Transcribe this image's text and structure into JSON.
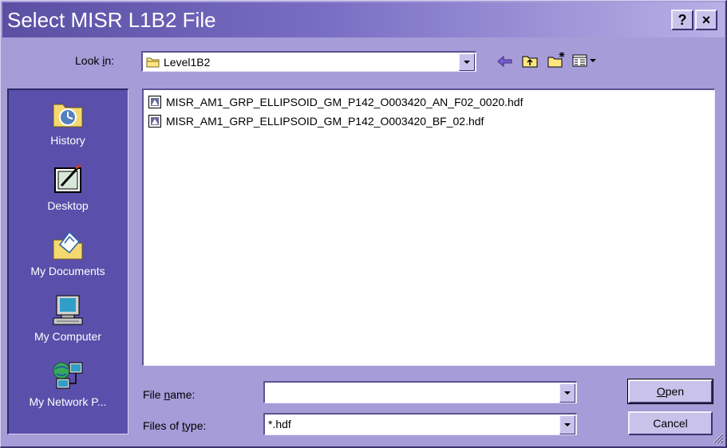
{
  "window": {
    "title": "Select MISR L1B2 File",
    "help_button": "?",
    "close_button": "×"
  },
  "look_in": {
    "label_prefix": "Look ",
    "label_key": "i",
    "label_suffix": "n:",
    "value": "Level1B2"
  },
  "toolbar": {
    "icons": [
      "back-arrow-icon",
      "up-one-level-icon",
      "new-folder-icon",
      "view-menu-icon"
    ]
  },
  "places": [
    {
      "label": "History",
      "icon": "history-icon"
    },
    {
      "label": "Desktop",
      "icon": "desktop-icon"
    },
    {
      "label": "My Documents",
      "icon": "my-documents-icon"
    },
    {
      "label": "My Computer",
      "icon": "my-computer-icon"
    },
    {
      "label": "My Network P...",
      "icon": "network-places-icon"
    }
  ],
  "files": [
    {
      "name": "MISR_AM1_GRP_ELLIPSOID_GM_P142_O003420_AN_F02_0020.hdf"
    },
    {
      "name": "MISR_AM1_GRP_ELLIPSOID_GM_P142_O003420_BF_02.hdf"
    }
  ],
  "file_name": {
    "label_prefix": "File ",
    "label_key": "n",
    "label_suffix": "ame:",
    "value": ""
  },
  "file_type": {
    "label_prefix": "Files of ",
    "label_key": "t",
    "label_suffix": "ype:",
    "value": "*.hdf"
  },
  "buttons": {
    "open_key": "O",
    "open_rest": "pen",
    "cancel": "Cancel"
  },
  "colors": {
    "title_start": "#5b4fa4",
    "title_end": "#b9b0e6",
    "face": "#a59cd8",
    "places_bar": "#5a4faa"
  }
}
